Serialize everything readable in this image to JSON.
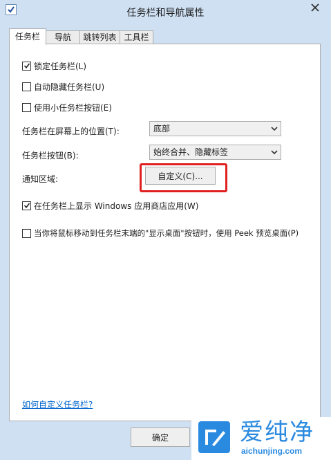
{
  "window": {
    "title": "任务栏和导航属性"
  },
  "tabs": [
    {
      "label": "任务栏"
    },
    {
      "label": "导航"
    },
    {
      "label": "跳转列表"
    },
    {
      "label": "工具栏"
    }
  ],
  "taskbar_tab": {
    "lock_taskbar": {
      "label": "锁定任务栏(L)",
      "checked": true
    },
    "auto_hide": {
      "label": "自动隐藏任务栏(U)",
      "checked": false
    },
    "small_buttons": {
      "label": "使用小任务栏按钮(E)",
      "checked": false
    },
    "position": {
      "label": "任务栏在屏幕上的位置(T):",
      "value": "底部"
    },
    "buttons": {
      "label": "任务栏按钮(B):",
      "value": "始终合并、隐藏标签"
    },
    "notification_area": {
      "label": "通知区域:",
      "button": "自定义(C)..."
    },
    "show_store_apps": {
      "label": "在任务栏上显示 Windows 应用商店应用(W)",
      "checked": true
    },
    "peek": {
      "label": "当你将鼠标移动到任务栏末端的\"显示桌面\"按钮时，使用 Peek 预览桌面(P)",
      "checked": false
    },
    "help_link": "如何自定义任务栏?"
  },
  "footer": {
    "ok_label": "确定"
  },
  "watermark": {
    "title": "爱纯净",
    "url": "aichunjing.com"
  },
  "colors": {
    "highlight": "#e02020",
    "link": "#0066cc",
    "brand": "#2a8ae0"
  }
}
